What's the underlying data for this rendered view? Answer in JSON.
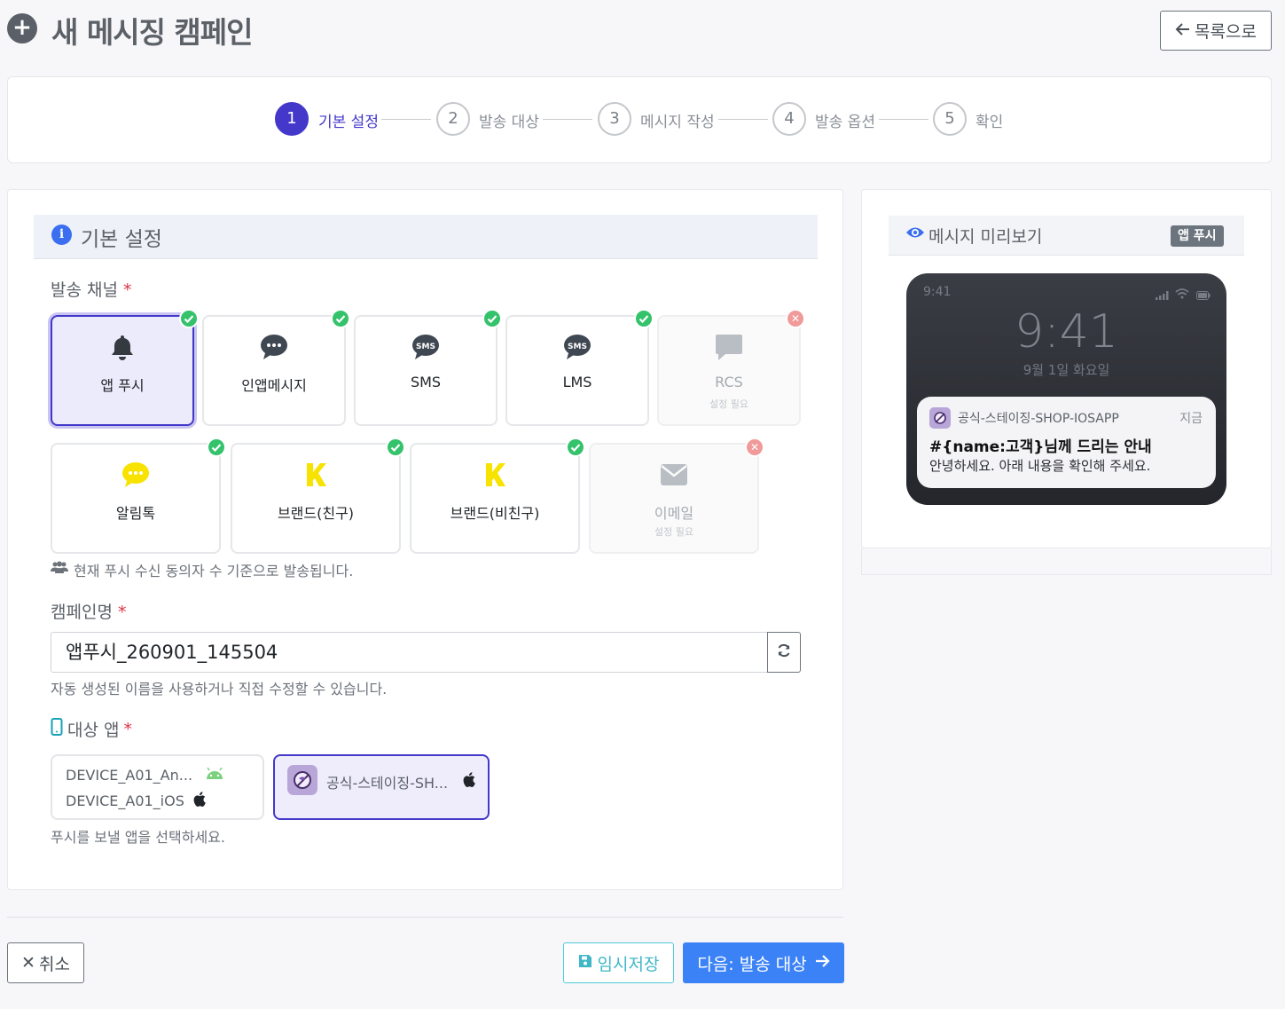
{
  "header": {
    "title": "새 메시징 캠페인",
    "back_label": "목록으로"
  },
  "stepper": {
    "current": 1,
    "steps": [
      {
        "num": "1",
        "label": "기본 설정"
      },
      {
        "num": "2",
        "label": "발송 대상"
      },
      {
        "num": "3",
        "label": "메시지 작성"
      },
      {
        "num": "4",
        "label": "발송 옵션"
      },
      {
        "num": "5",
        "label": "확인"
      }
    ]
  },
  "form": {
    "section_title": "기본 설정",
    "channel_label": "발송 채널",
    "required_mark": "*",
    "channels_row1": [
      {
        "label": "앱 푸시",
        "icon": "bell-icon",
        "status": "ok",
        "selected": true
      },
      {
        "label": "인앱메시지",
        "icon": "chat-bubble-icon",
        "status": "ok"
      },
      {
        "label": "SMS",
        "icon": "sms-icon",
        "status": "ok",
        "icon_text": "SMS"
      },
      {
        "label": "LMS",
        "icon": "sms-icon",
        "status": "ok",
        "icon_text": "SMS"
      },
      {
        "label": "RCS",
        "icon": "message-square-icon",
        "status": "disabled",
        "sub": "설정 필요"
      }
    ],
    "channels_row2": [
      {
        "label": "알림톡",
        "icon": "kakao-chat-icon",
        "status": "ok"
      },
      {
        "label": "브랜드(친구)",
        "icon": "kakao-k-icon",
        "status": "ok"
      },
      {
        "label": "브랜드(비친구)",
        "icon": "kakao-k-icon",
        "status": "ok"
      },
      {
        "label": "이메일",
        "icon": "envelope-icon",
        "status": "disabled",
        "sub": "설정 필요"
      }
    ],
    "channel_help": "현재 푸시 수신 동의자 수 기준으로 발송됩니다.",
    "campaign_name_label": "캠페인명",
    "campaign_name_value": "앱푸시_260901_145504",
    "campaign_name_help": "자동 생성된 이름을 사용하거나 직접 수정할 수 있습니다.",
    "target_app_label": "대상 앱",
    "apps": {
      "group1": [
        "DEVICE_A01_An...",
        "DEVICE_A01_iOS"
      ],
      "selected_app": "공식-스테이징-SH..."
    },
    "target_app_help": "푸시를 보낼 앱을 선택하세요."
  },
  "footer": {
    "cancel_label": "취소",
    "draft_label": "임시저장",
    "next_label": "다음: 발송 대상"
  },
  "preview": {
    "title": "메시지 미리보기",
    "badge": "앱 푸시",
    "status_time": "9:41",
    "lock_time": "9:41",
    "lock_date": "9월 1일 화요일",
    "notif_app": "공식-스테이징-SHOP-IOSAPP",
    "notif_time": "지금",
    "notif_title": "#{name:고객}님께 드리는 안내",
    "notif_body": "안녕하세요. 아래 내용을 확인해 주세요."
  },
  "colors": {
    "primary": "#4338ca",
    "success": "#34c26b",
    "danger": "#dc3545",
    "info": "#3b82f6",
    "kakao": "#f7e200"
  }
}
